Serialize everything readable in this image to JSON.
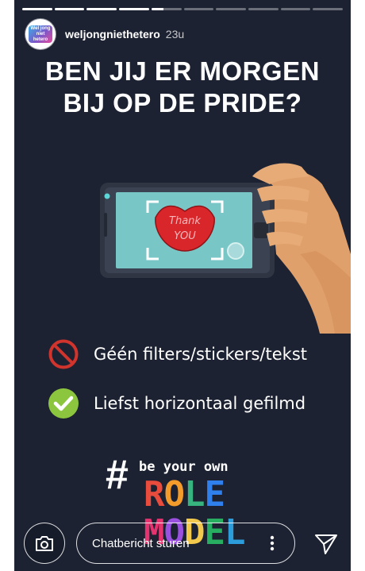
{
  "story": {
    "background": "#1c2232",
    "progress": [
      1,
      1,
      1,
      1,
      0.4,
      0,
      0,
      0,
      0,
      0
    ]
  },
  "header": {
    "avatar_text_line1": "Wel jong",
    "avatar_text_line2": "niet hetero",
    "username": "weljongniethetero",
    "time": "23u"
  },
  "headline": {
    "line1": "BEN JIJ ER MORGEN",
    "line2": "BIJ OP DE PRIDE?"
  },
  "illustration": {
    "sticker_line1": "Thank",
    "sticker_line2": "YOU"
  },
  "rules": [
    {
      "icon": "prohibited-icon",
      "text": "Géén filters/stickers/tekst"
    },
    {
      "icon": "checkmark-icon",
      "text": "Liefst horizontaal gefilmd"
    }
  ],
  "brand": {
    "hashtag": "#",
    "tagline": "be your own",
    "word1": "ROLE",
    "word2": "MODEL",
    "word1_colors": [
      "#e94b3c",
      "#f39c2b",
      "#36b37e",
      "#2f80ed"
    ],
    "word2_colors": [
      "#e6336f",
      "#9b51e0",
      "#f2c94c",
      "#27ae60",
      "#2d9cdb"
    ]
  },
  "composer": {
    "placeholder": "Chatbericht sturen"
  }
}
